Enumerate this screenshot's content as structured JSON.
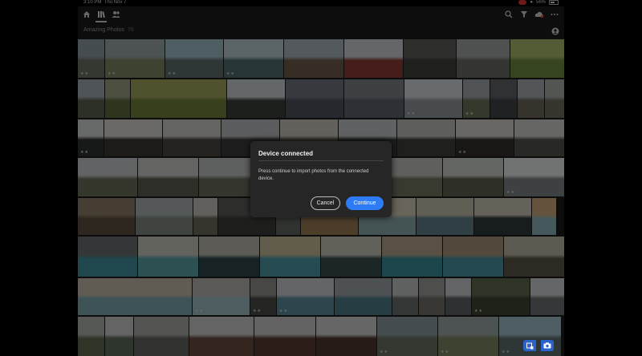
{
  "status": {
    "time": "3:10 PM",
    "date": "Thu Nov 7",
    "battery": "56%",
    "icons": [
      "screen-record-icon",
      "wifi-icon",
      "battery-icon"
    ]
  },
  "toolbar": {
    "left_icons": [
      "home-icon",
      "library-icon",
      "people-icon"
    ],
    "right_icons": [
      "search-icon",
      "filter-icon",
      "cloud-sync-icon",
      "more-icon"
    ]
  },
  "album": {
    "title": "Amazing Photos",
    "count": "76"
  },
  "dialog": {
    "title": "Device connected",
    "message": "Press continue to import photos from the connected device.",
    "cancel_label": "Cancel",
    "continue_label": "Continue"
  },
  "fab": {
    "icons": [
      "import-icon",
      "camera-icon"
    ]
  },
  "photos": [
    {
      "c1": "#8d9aa0",
      "c2": "#6a6f63",
      "stars": "★★"
    },
    {
      "c1": "#9aa6a5",
      "c2": "#7d8560",
      "stars": "★★"
    },
    {
      "c1": "#9ebcc7",
      "c2": "#5f6e6d",
      "stars": "★★"
    },
    {
      "c1": "#b6c8cf",
      "c2": "#4f6b6f",
      "stars": "★★"
    },
    {
      "c1": "#a8b3bd",
      "c2": "#6d5b4a",
      "stars": ""
    },
    {
      "c1": "#c9cdd3",
      "c2": "#8a3b36",
      "stars": ""
    },
    {
      "c1": "#5b5d59",
      "c2": "#3e3f3c",
      "stars": ""
    },
    {
      "c1": "#9fa3a0",
      "c2": "#6a6c67",
      "stars": ""
    },
    {
      "c1": "#a9b86c",
      "c2": "#6f8a3e",
      "stars": ""
    },
    {
      "c1": "#b9c6cf",
      "c2": "#7d8c59",
      "stars": ""
    },
    {
      "c1": "#9ea8b2",
      "c2": "#59604c",
      "stars": ""
    },
    {
      "c1": "#9aa083",
      "c2": "#5b6b3e",
      "stars": ""
    },
    {
      "c1": "#9fa55a",
      "c2": "#6e7e3a",
      "stars": ""
    },
    {
      "c1": "#c8cfd1",
      "c2": "#3a3f3a",
      "stars": ""
    },
    {
      "c1": "#6c747c",
      "c2": "#4a5158",
      "stars": ""
    },
    {
      "c1": "#7c8389",
      "c2": "#5a6168",
      "stars": ""
    },
    {
      "c1": "#d0d6da",
      "c2": "#8e979c",
      "stars": "★★"
    },
    {
      "c1": "#9ea7ad",
      "c2": "#6b7257",
      "stars": "★★"
    },
    {
      "c1": "#5e6267",
      "c2": "#3f4247",
      "stars": ""
    },
    {
      "c1": "#a6acb2",
      "c2": "#6a6658",
      "stars": ""
    },
    {
      "c1": "#a7aaa6",
      "c2": "#6d6a5c",
      "stars": ""
    },
    {
      "c1": "#cfd2d3",
      "c2": "#2f3030",
      "stars": "★★"
    },
    {
      "c1": "#d5d3cc",
      "c2": "#3a3631",
      "stars": ""
    },
    {
      "c1": "#c9c8c1",
      "c2": "#4b4740",
      "stars": ""
    },
    {
      "c1": "#b7b9ba",
      "c2": "#3b3b3a",
      "stars": ""
    },
    {
      "c1": "#c5c2b7",
      "c2": "#57524a",
      "stars": ""
    },
    {
      "c1": "#c1c3c4",
      "c2": "#373838",
      "stars": ""
    },
    {
      "c1": "#bcbdb8",
      "c2": "#3f3f3c",
      "stars": ""
    },
    {
      "c1": "#d0cfc8",
      "c2": "#302e2a",
      "stars": "★★"
    },
    {
      "c1": "#cdcdc9",
      "c2": "#505049",
      "stars": ""
    },
    {
      "c1": "#c9cbc9",
      "c2": "#3b3d3b",
      "stars": ""
    },
    {
      "c1": "#c4c7c8",
      "c2": "#6a6e5a",
      "stars": ""
    },
    {
      "c1": "#c8c9c5",
      "c2": "#5b5d4e",
      "stars": ""
    },
    {
      "c1": "#bcc0bf",
      "c2": "#6a6d5c",
      "stars": ""
    },
    {
      "c1": "#9ea3a1",
      "c2": "#5f6355",
      "stars": ""
    },
    {
      "c1": "#cfd1cc",
      "c2": "#676b5c",
      "stars": ""
    },
    {
      "c1": "#bec1bc",
      "c2": "#70735f",
      "stars": ""
    },
    {
      "c1": "#c9ccc7",
      "c2": "#5d604f",
      "stars": ""
    },
    {
      "c1": "#e3e5e4",
      "c2": "#7d8282",
      "stars": "★★"
    },
    {
      "c1": "#8c7b66",
      "c2": "#5d4f3e",
      "stars": ""
    },
    {
      "c1": "#a9b1b3",
      "c2": "#7e8880",
      "stars": ""
    },
    {
      "c1": "#c3c1b8",
      "c2": "#6b6a5d",
      "stars": ""
    },
    {
      "c1": "#5a5a58",
      "c2": "#3d3d3b",
      "stars": ""
    },
    {
      "c1": "#c7c9c6",
      "c2": "#616560",
      "stars": ""
    },
    {
      "c1": "#cbb38c",
      "c2": "#9a7d55",
      "stars": ""
    },
    {
      "c1": "#cfc9b4",
      "c2": "#88a7a6",
      "stars": ""
    },
    {
      "c1": "#c2bda8",
      "c2": "#5e7f86",
      "stars": ""
    },
    {
      "c1": "#c9c4b3",
      "c2": "#2f3a3b",
      "stars": ""
    },
    {
      "c1": "#caa67a",
      "c2": "#8bb2b8",
      "stars": ""
    },
    {
      "c1": "#6b6d6e",
      "c2": "#3e8e9a",
      "stars": ""
    },
    {
      "c1": "#c7c6bd",
      "c2": "#5aa0a7",
      "stars": ""
    },
    {
      "c1": "#b9b6aa",
      "c2": "#2f4549",
      "stars": ""
    },
    {
      "c1": "#c4b999",
      "c2": "#4c98a3",
      "stars": ""
    },
    {
      "c1": "#c5c2b4",
      "c2": "#3a4c4f",
      "stars": ""
    },
    {
      "c1": "#b2a38c",
      "c2": "#3a8a98",
      "stars": ""
    },
    {
      "c1": "#a8937a",
      "c2": "#4a93a0",
      "stars": ""
    },
    {
      "c1": "#b9b2a3",
      "c2": "#5a5347",
      "stars": ""
    },
    {
      "c1": "#c0b8a6",
      "c2": "#7aa6ac",
      "stars": ""
    },
    {
      "c1": "#b5b3ab",
      "c2": "#9cbcc0",
      "stars": "★★"
    },
    {
      "c1": "#8e8f8d",
      "c2": "#4a4b49",
      "stars": "★★"
    },
    {
      "c1": "#c7cbce",
      "c2": "#5a8a9a",
      "stars": "★★"
    },
    {
      "c1": "#9aa3a9",
      "c2": "#4d7d87",
      "stars": ""
    },
    {
      "c1": "#c0c4c5",
      "c2": "#6b6f6e",
      "stars": ""
    },
    {
      "c1": "#9c9d99",
      "c2": "#706f69",
      "stars": ""
    },
    {
      "c1": "#c6c9ca",
      "c2": "#5d6062",
      "stars": ""
    },
    {
      "c1": "#5f6a4c",
      "c2": "#3c4433",
      "stars": "★★"
    },
    {
      "c1": "#c9ccce",
      "c2": "#6b7070",
      "stars": ""
    },
    {
      "c1": "#aab0ab",
      "c2": "#5e6b4c",
      "stars": ""
    },
    {
      "c1": "#c6c8c7",
      "c2": "#5d6a58",
      "stars": ""
    },
    {
      "c1": "#a8aaa7",
      "c2": "#646760",
      "stars": ""
    },
    {
      "c1": "#c7c8c6",
      "c2": "#6b4a3e",
      "stars": ""
    },
    {
      "c1": "#c5c6c4",
      "c2": "#5a3a32",
      "stars": ""
    },
    {
      "c1": "#cacccb",
      "c2": "#4f3630",
      "stars": ""
    }
  ]
}
